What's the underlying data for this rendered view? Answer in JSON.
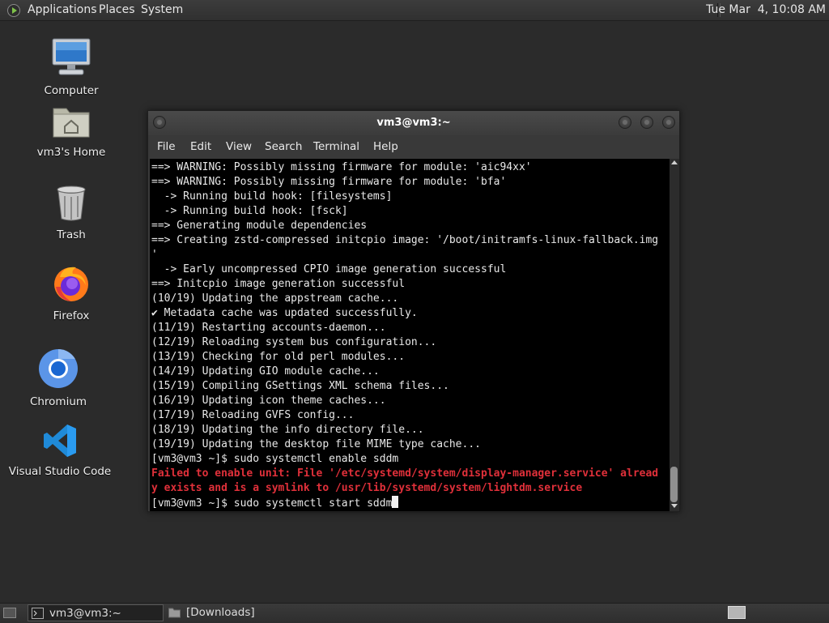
{
  "top_panel": {
    "menus": [
      "Applications",
      "Places",
      "System"
    ],
    "clock": "Tue Mar  4, 10:08 AM"
  },
  "desktop_icons": [
    {
      "label": "Computer",
      "icon": "computer-icon"
    },
    {
      "label": "vm3's Home",
      "icon": "home-folder-icon"
    },
    {
      "label": "Trash",
      "icon": "trash-icon"
    },
    {
      "label": "Firefox",
      "icon": "firefox-icon"
    },
    {
      "label": "Chromium",
      "icon": "chromium-icon"
    },
    {
      "label": "Visual Studio Code",
      "icon": "vscode-icon"
    }
  ],
  "terminal": {
    "title": "vm3@vm3:~",
    "menu": [
      "File",
      "Edit",
      "View",
      "Search",
      "Terminal",
      "Help"
    ],
    "lines": [
      "==> WARNING: Possibly missing firmware for module: 'aic94xx'",
      "==> WARNING: Possibly missing firmware for module: 'bfa'",
      "  -> Running build hook: [filesystems]",
      "  -> Running build hook: [fsck]",
      "==> Generating module dependencies",
      "==> Creating zstd-compressed initcpio image: '/boot/initramfs-linux-fallback.img",
      "'",
      "  -> Early uncompressed CPIO image generation successful",
      "==> Initcpio image generation successful",
      "(10/19) Updating the appstream cache...",
      "✔ Metadata cache was updated successfully.",
      "(11/19) Restarting accounts-daemon...",
      "(12/19) Reloading system bus configuration...",
      "(13/19) Checking for old perl modules...",
      "(14/19) Updating GIO module cache...",
      "(15/19) Compiling GSettings XML schema files...",
      "(16/19) Updating icon theme caches...",
      "(17/19) Reloading GVFS config...",
      "(18/19) Updating the info directory file...",
      "(19/19) Updating the desktop file MIME type cache...",
      "[vm3@vm3 ~]$ sudo systemctl enable sddm",
      "Failed to enable unit: File '/etc/systemd/system/display-manager.service' alread",
      "y exists and is a symlink to /usr/lib/systemd/system/lightdm.service"
    ],
    "error_color": "#e0303a",
    "prompt": "[vm3@vm3 ~]$ sudo systemctl start sddm"
  },
  "taskbar": {
    "tasks": [
      {
        "label": "vm3@vm3:~",
        "icon": "terminal-icon",
        "active": true
      },
      {
        "label": "[Downloads]",
        "icon": "folder-icon",
        "active": false
      }
    ]
  }
}
